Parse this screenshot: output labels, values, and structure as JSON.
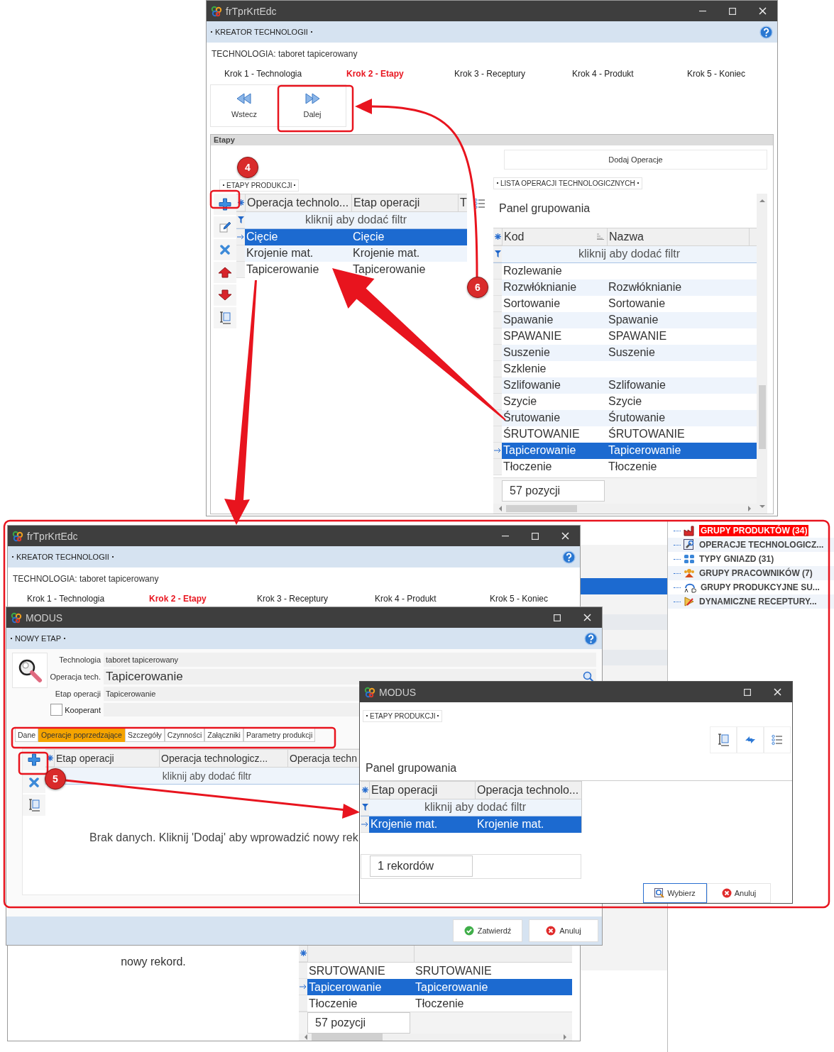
{
  "main_window": {
    "title": "frTprKrtEdc",
    "header": "KREATOR TECHNOLOGII",
    "technology": "TECHNOLOGIA: taboret tapicerowany",
    "steps": [
      {
        "label": "Krok 1 - Technologia",
        "selected": false
      },
      {
        "label": "Krok 2 - Etapy",
        "selected": true
      },
      {
        "label": "Krok 3 - Receptury",
        "selected": false
      },
      {
        "label": "Krok 4 - Produkt",
        "selected": false
      },
      {
        "label": "Krok 5 - Koniec",
        "selected": false
      }
    ],
    "nav_buttons": [
      {
        "label": "Wstecz",
        "kind": "back"
      },
      {
        "label": "Dalej",
        "kind": "next"
      }
    ],
    "section": "Etapy",
    "add_button": "Dodaj Operacje",
    "stages": {
      "title": "ETAPY PRODUKCJI",
      "columns": [
        "Operacja technolo...",
        "Etap operacji",
        "T"
      ],
      "filter_hint": "kliknij aby dodać filtr",
      "rows": [
        {
          "cells": [
            "Cięcie",
            "Cięcie"
          ],
          "selected": true
        },
        {
          "cells": [
            "Krojenie mat.",
            "Krojenie mat."
          ],
          "selected": false
        },
        {
          "cells": [
            "Tapicerowanie",
            "Tapicerowanie"
          ],
          "selected": false
        }
      ]
    },
    "operations": {
      "title": "LISTA OPERACJI TECHNOLOGICZNYCH",
      "group_panel": "Panel grupowania",
      "columns": [
        {
          "label": "Kod",
          "sorted": true
        },
        {
          "label": "Nazwa",
          "sorted": false
        }
      ],
      "filter_hint": "kliknij aby dodać filtr",
      "rows": [
        {
          "cells": [
            "Rozlewanie"
          ],
          "selected": false
        },
        {
          "cells": [
            "Rozwłóknianie",
            "Rozwłóknianie"
          ],
          "selected": false
        },
        {
          "cells": [
            "Sortowanie",
            "Sortowanie"
          ],
          "selected": false
        },
        {
          "cells": [
            "Spawanie",
            "Spawanie"
          ],
          "selected": false
        },
        {
          "cells": [
            "SPAWANIE",
            "SPAWANIE"
          ],
          "selected": false
        },
        {
          "cells": [
            "Suszenie",
            "Suszenie"
          ],
          "selected": false
        },
        {
          "cells": [
            "Szklenie"
          ],
          "selected": false
        },
        {
          "cells": [
            "Szlifowanie",
            "Szlifowanie"
          ],
          "selected": false
        },
        {
          "cells": [
            "Szycie",
            "Szycie"
          ],
          "selected": false
        },
        {
          "cells": [
            "Śrutowanie",
            "Śrutowanie"
          ],
          "selected": false
        },
        {
          "cells": [
            "ŚRUTOWANIE",
            "ŚRUTOWANIE"
          ],
          "selected": false
        },
        {
          "cells": [
            "Tapicerowanie",
            "Tapicerowanie"
          ],
          "selected": true
        },
        {
          "cells": [
            "Tłoczenie",
            "Tłoczenie"
          ],
          "selected": false
        }
      ],
      "count": "57 pozycji"
    }
  },
  "back_window": {
    "title": "frTprKrtEdc",
    "header": "KREATOR TECHNOLOGII",
    "technology": "TECHNOLOGIA: taboret tapicerowany",
    "steps": [
      {
        "label": "Krok 1 - Technologia",
        "selected": false
      },
      {
        "label": "Krok 2 - Etapy",
        "selected": true
      },
      {
        "label": "Krok 3 - Receptury",
        "selected": false
      },
      {
        "label": "Krok 4 - Produkt",
        "selected": false
      },
      {
        "label": "Krok 5 - Koniec",
        "selected": false
      }
    ],
    "empty_hint": "nowy rekord.",
    "rows": [
      {
        "cells": [
          "SRUTOWANIE",
          "SRUTOWANIE"
        ],
        "selected": false
      },
      {
        "cells": [
          "Tapicerowanie",
          "Tapicerowanie"
        ],
        "selected": true
      },
      {
        "cells": [
          "Tłoczenie",
          "Tłoczenie"
        ],
        "selected": false
      }
    ],
    "count": "57 pozycji"
  },
  "tree": [
    {
      "label": "GRUPY PRODUKTÓW (34)",
      "kind": "factory",
      "selected": true
    },
    {
      "label": "OPERACJE TECHNOLOGICZ...",
      "kind": "wrench",
      "selected": false
    },
    {
      "label": "TYPY GNIAZD (31)",
      "kind": "grid",
      "selected": false
    },
    {
      "label": "GRUPY PRACOWNIKÓW (7)",
      "kind": "people",
      "selected": false
    },
    {
      "label": "GRUPY PRODUKCYJNE SU...",
      "kind": "letters",
      "selected": false
    },
    {
      "label": "DYNAMICZNE RECEPTURY...",
      "kind": "pencil",
      "selected": false
    }
  ],
  "stage_window": {
    "title": "MODUS",
    "header": "NOWY ETAP",
    "fields": [
      {
        "label": "Technologia",
        "value": "taboret tapicerowany",
        "kind": "small"
      },
      {
        "label": "Operacja tech.",
        "value": "Tapicerowanie",
        "kind": "large"
      },
      {
        "label": "Etap operacji",
        "value": "Tapicerowanie",
        "kind": "small"
      }
    ],
    "cooperant": {
      "label": "Kooperant",
      "checked": false
    },
    "tabs": [
      {
        "label": "Dane",
        "selected": false
      },
      {
        "label": "Operacje poprzedzające",
        "selected": true
      },
      {
        "label": "Szczegóły",
        "selected": false
      },
      {
        "label": "Czynności",
        "selected": false
      },
      {
        "label": "Załączniki",
        "selected": false
      },
      {
        "label": "Parametry produkcji",
        "selected": false
      }
    ],
    "grid": {
      "columns": [
        "Etap operacji",
        "Operacja technologicz...",
        "Operacja techn"
      ],
      "filter_hint": "kliknij aby dodać filtr"
    },
    "empty_message": "Brak danych. Kliknij 'Dodaj' aby wprowadzić nowy rek",
    "buttons": [
      {
        "label": "Zatwierdź",
        "kind": "confirm"
      },
      {
        "label": "Anuluj",
        "kind": "cancel"
      }
    ]
  },
  "picker_window": {
    "title": "MODUS",
    "panel_title": "ETAPY PRODUKCJI",
    "group_panel": "Panel grupowania",
    "grid": {
      "columns": [
        "Etap operacji",
        "Operacja technolo..."
      ],
      "filter_hint": "kliknij aby dodać filtr",
      "rows": [
        {
          "cells": [
            "Krojenie mat.",
            "Krojenie mat."
          ],
          "selected": true
        }
      ]
    },
    "count": "1 rekordów",
    "buttons": [
      {
        "label": "Wybierz",
        "kind": "select"
      },
      {
        "label": "Anuluj",
        "kind": "cancel"
      }
    ]
  },
  "callouts": [
    {
      "label": "4"
    },
    {
      "label": "5"
    },
    {
      "label": "6"
    }
  ]
}
